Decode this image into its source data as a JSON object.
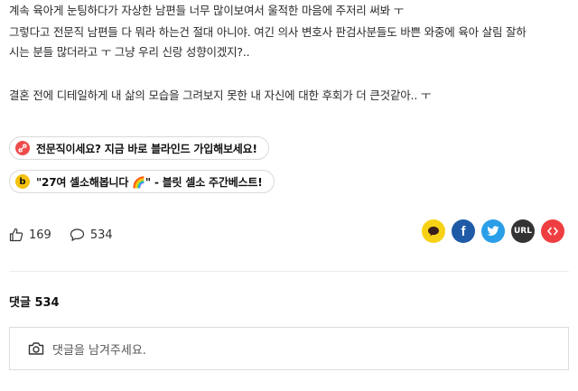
{
  "post": {
    "lines": [
      "계속 육아게 눈팅하다가 자상한 남편들 너무 많이보여서 울적한 마음에 주저리 써봐 ㅜ",
      "그렇다고 전문직 남편들 다 뭐라 하는건 절대 아니야. 여긴 의사 변호사 판검사분들도 바쁜 와중에 육아 살림 잘하",
      "시는 분들 많더라고 ㅜ 그냥 우리 신랑 성향이겠지?..",
      "결혼 전에 디테일하게 내 삶의 모습을 그려보지 못한 내 자신에 대한 후회가 더 큰것같아.. ㅜ"
    ]
  },
  "promos": [
    {
      "icon": "link-icon",
      "color": "#ef4b4b",
      "text": "전문직이세요? 지금 바로 블라인드 가입해보세요!"
    },
    {
      "icon": "b-badge-icon",
      "color": "#f4c20d",
      "glyph": "b",
      "text": "\"27여 셀소해봅니다 🌈\" - 블릿 셀소 주간베스트!"
    }
  ],
  "stats": {
    "likes": "169",
    "comments": "534"
  },
  "share": [
    {
      "name": "kakao-share-button",
      "color": "#f7d116"
    },
    {
      "name": "facebook-share-button",
      "color": "#1e5aa6",
      "glyph": "f"
    },
    {
      "name": "twitter-share-button",
      "color": "#2a9ee8"
    },
    {
      "name": "url-copy-button",
      "color": "#333333",
      "glyph": "URL"
    },
    {
      "name": "embed-button",
      "color": "#ef3e42"
    }
  ],
  "comments": {
    "title": "댓글 534",
    "placeholder": "댓글을 남겨주세요."
  }
}
